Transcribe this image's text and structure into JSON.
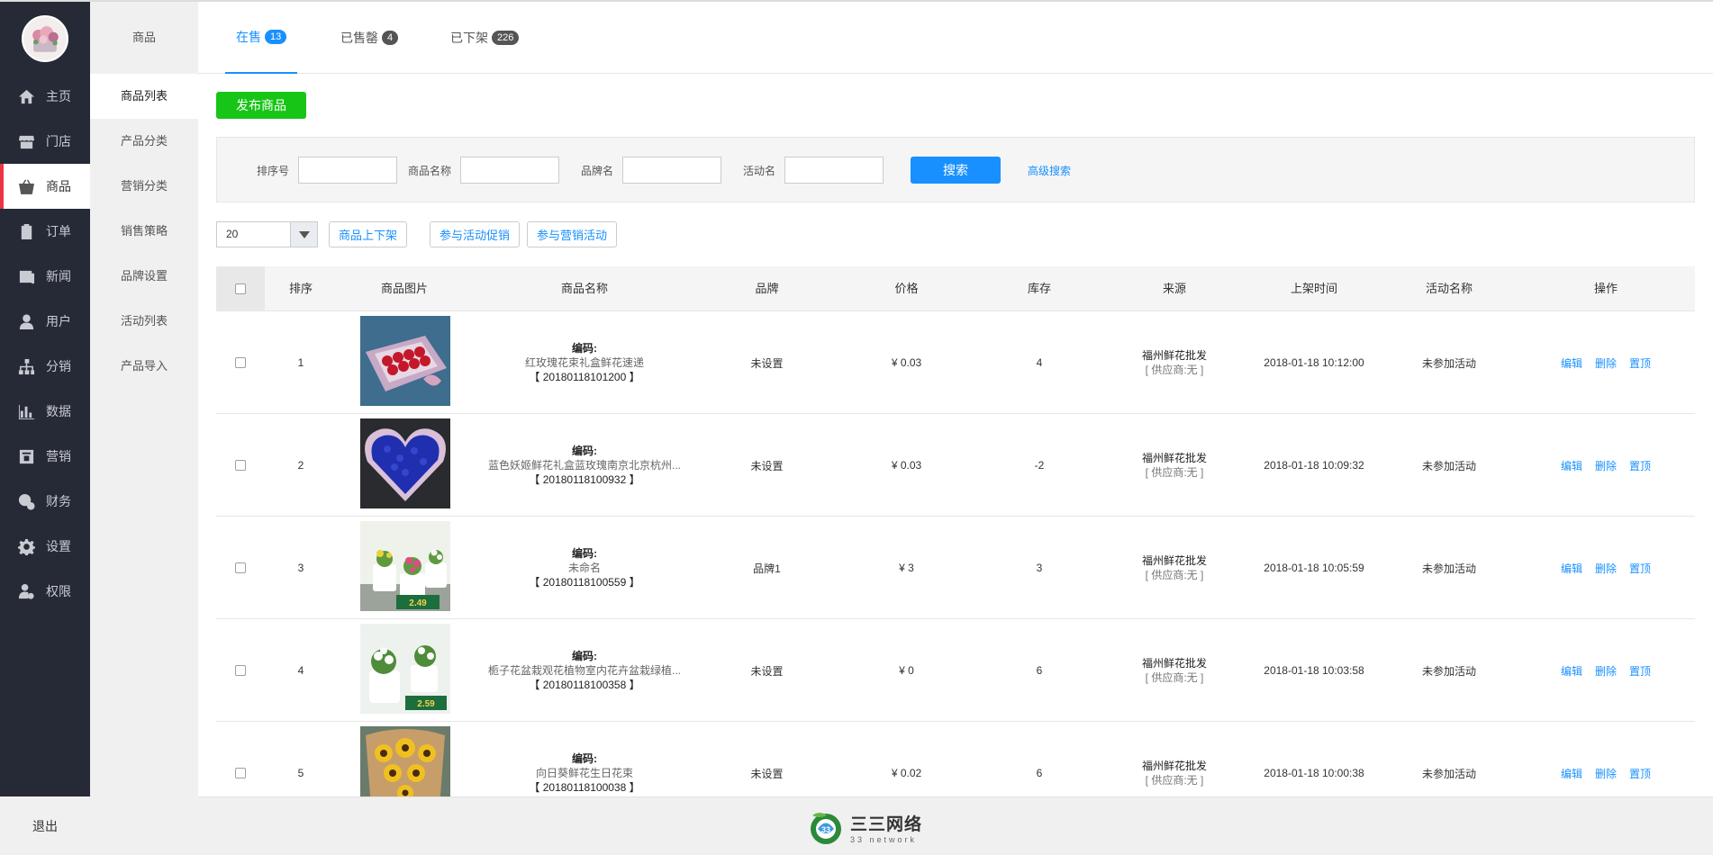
{
  "nav": {
    "items": [
      {
        "label": "主页",
        "icon": "home-icon"
      },
      {
        "label": "门店",
        "icon": "store-icon"
      },
      {
        "label": "商品",
        "icon": "basket-icon"
      },
      {
        "label": "订单",
        "icon": "clipboard-icon"
      },
      {
        "label": "新闻",
        "icon": "news-icon"
      },
      {
        "label": "用户",
        "icon": "user-icon"
      },
      {
        "label": "分销",
        "icon": "network-icon"
      },
      {
        "label": "数据",
        "icon": "bar-chart-icon"
      },
      {
        "label": "营销",
        "icon": "marketing-icon"
      },
      {
        "label": "财务",
        "icon": "finance-icon"
      },
      {
        "label": "设置",
        "icon": "gear-icon"
      },
      {
        "label": "权限",
        "icon": "permission-icon"
      }
    ],
    "active_index": 2,
    "logout": "退出"
  },
  "subnav": {
    "title": "商品",
    "items": [
      "商品列表",
      "产品分类",
      "营销分类",
      "销售策略",
      "品牌设置",
      "活动列表",
      "产品导入"
    ]
  },
  "tabs": [
    {
      "label": "在售",
      "count": "13"
    },
    {
      "label": "已售罄",
      "count": "4"
    },
    {
      "label": "已下架",
      "count": "226"
    }
  ],
  "publish_button": "发布商品",
  "search": {
    "sort_label": "排序号",
    "name_label": "商品名称",
    "brand_label": "品牌名",
    "activity_label": "活动名",
    "search_button": "搜索",
    "advanced_link": "高级搜索"
  },
  "toolbar": {
    "page_size": "20",
    "toggle_shelf": "商品上下架",
    "join_promo": "参与活动促销",
    "join_marketing": "参与营销活动"
  },
  "table": {
    "headers": {
      "sort": "排序",
      "image": "商品图片",
      "name": "商品名称",
      "brand": "品牌",
      "price": "价格",
      "stock": "库存",
      "source": "来源",
      "time": "上架时间",
      "activity": "活动名称",
      "ops": "操作"
    },
    "rows": [
      {
        "sort": "1",
        "code_label": "编码:",
        "name": "红玫瑰花束礼盒鲜花速递",
        "code": "【 20180118101200 】",
        "brand": "未设置",
        "price": "¥ 0.03",
        "stock": "4",
        "source": "福州鲜花批发",
        "supplier": "[ 供应商:无 ]",
        "time": "2018-01-18 10:12:00",
        "activity": "未参加活动",
        "edit": "编辑",
        "delete": "删除",
        "top": "置顶",
        "image": "rose-box"
      },
      {
        "sort": "2",
        "code_label": "编码:",
        "name": "蓝色妖姬鲜花礼盒蓝玫瑰南京北京杭州...",
        "code": "【 20180118100932 】",
        "brand": "未设置",
        "price": "¥ 0.03",
        "stock": "-2",
        "source": "福州鲜花批发",
        "supplier": "[ 供应商:无 ]",
        "time": "2018-01-18 10:09:32",
        "activity": "未参加活动",
        "edit": "编辑",
        "delete": "删除",
        "top": "置顶",
        "image": "blue-heart"
      },
      {
        "sort": "3",
        "code_label": "编码:",
        "name": "未命名",
        "code": "【 20180118100559 】",
        "brand": "品牌1",
        "price": "¥ 3",
        "stock": "3",
        "source": "福州鲜花批发",
        "supplier": "[ 供应商:无 ]",
        "time": "2018-01-18 10:05:59",
        "activity": "未参加活动",
        "edit": "编辑",
        "delete": "删除",
        "top": "置顶",
        "image": "potted-flowers"
      },
      {
        "sort": "4",
        "code_label": "编码:",
        "name": "栀子花盆栽观花植物室内花卉盆栽绿植...",
        "code": "【 20180118100358 】",
        "brand": "未设置",
        "price": "¥ 0",
        "stock": "6",
        "source": "福州鲜花批发",
        "supplier": "[ 供应商:无 ]",
        "time": "2018-01-18 10:03:58",
        "activity": "未参加活动",
        "edit": "编辑",
        "delete": "删除",
        "top": "置顶",
        "image": "gardenia"
      },
      {
        "sort": "5",
        "code_label": "编码:",
        "name": "向日葵鲜花生日花束",
        "code": "【 20180118100038 】",
        "brand": "未设置",
        "price": "¥ 0.02",
        "stock": "6",
        "source": "福州鲜花批发",
        "supplier": "[ 供应商:无 ]",
        "time": "2018-01-18 10:00:38",
        "activity": "未参加活动",
        "edit": "编辑",
        "delete": "删除",
        "top": "置顶",
        "image": "sunflowers"
      }
    ]
  },
  "footer": {
    "brand_cn": "三三网络",
    "brand_en": "33 network"
  },
  "colors": {
    "accent": "#1890ff",
    "publish": "#17c517",
    "sidebar": "#262a36",
    "active_marker": "#ee3344"
  }
}
